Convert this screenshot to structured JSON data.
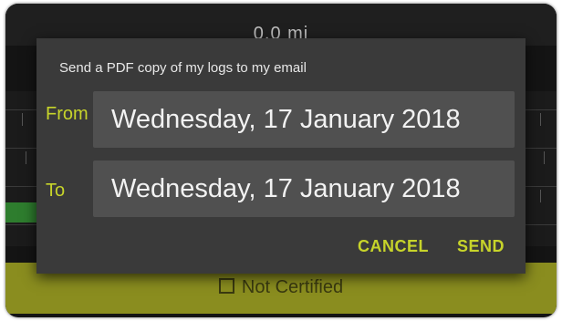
{
  "background": {
    "distance": "0.0 mi",
    "certification_label": "Not Certified"
  },
  "dialog": {
    "title": "Send a PDF copy of my logs to my email",
    "from_label": "From",
    "from_date": "Wednesday, 17 January 2018",
    "to_label": "To",
    "to_date": "Wednesday, 17 January 2018",
    "cancel_label": "CANCEL",
    "send_label": "SEND"
  },
  "colors": {
    "accent": "#c7d42a",
    "dialog_bg": "#3a3a3a",
    "field_bg": "#505050",
    "footer_bg": "#8a8d1f"
  }
}
